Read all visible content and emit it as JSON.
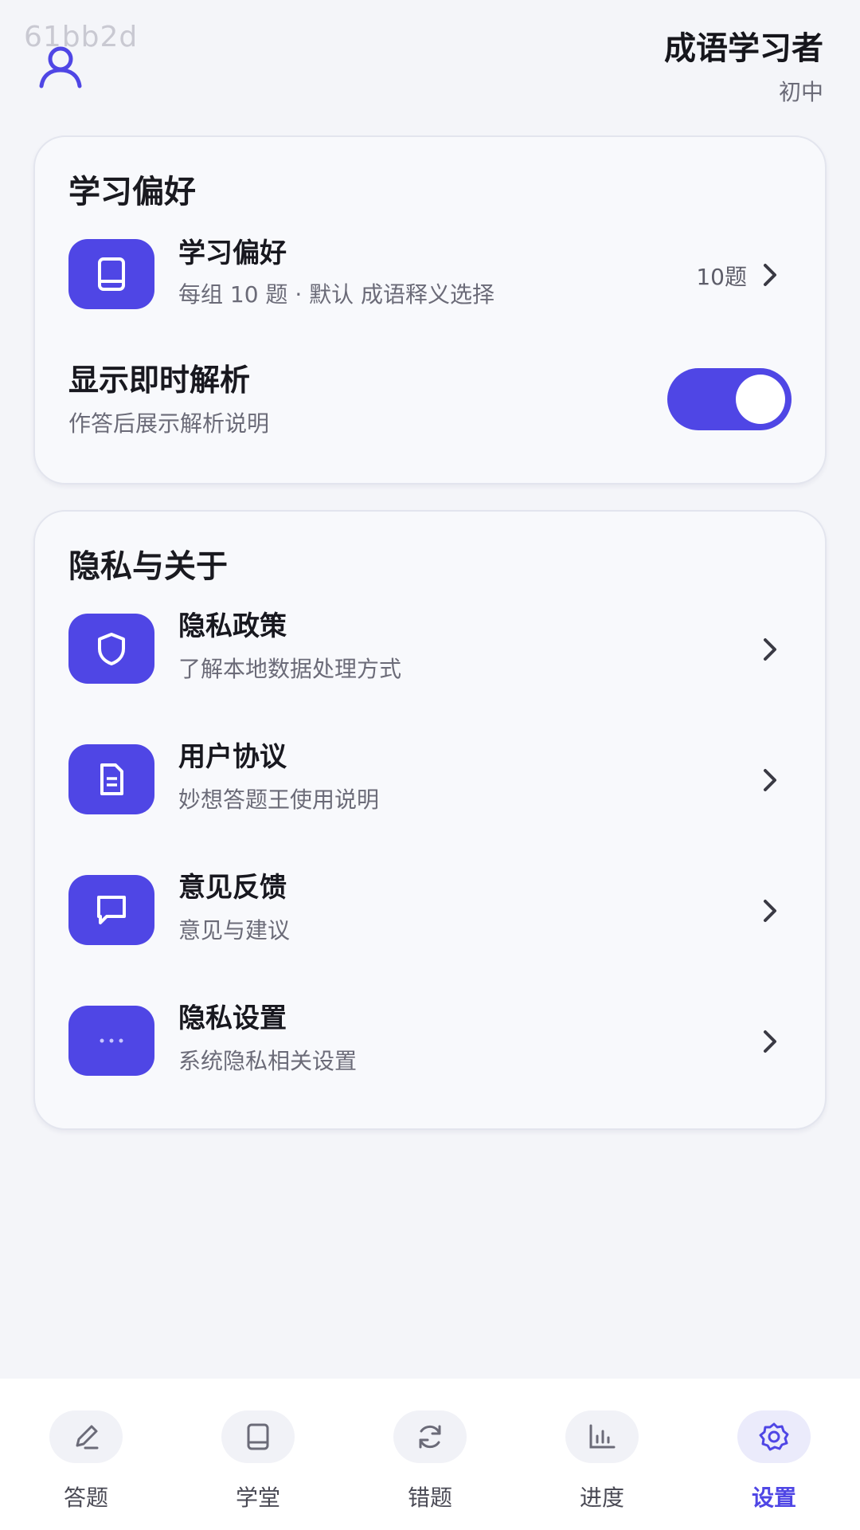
{
  "watermark": "61bb2d",
  "profile": {
    "name": "成语学习者",
    "level": "初中"
  },
  "colors": {
    "accent": "#4f46e5",
    "background": "#f4f5f9",
    "card": "#f8f9fc"
  },
  "learning_card": {
    "title": "学习偏好",
    "preference": {
      "icon": "book-icon",
      "title": "学习偏好",
      "subtitle": "每组 10 题 · 默认 成语释义选择",
      "value": "10题"
    },
    "explanation": {
      "title": "显示即时解析",
      "subtitle": "作答后展示解析说明",
      "enabled": true
    }
  },
  "privacy_card": {
    "title": "隐私与关于",
    "items": [
      {
        "icon": "shield-icon",
        "title": "隐私政策",
        "subtitle": "了解本地数据处理方式"
      },
      {
        "icon": "document-icon",
        "title": "用户协议",
        "subtitle": "妙想答题王使用说明"
      },
      {
        "icon": "message-icon",
        "title": "意见反馈",
        "subtitle": "意见与建议"
      },
      {
        "icon": "more-icon",
        "title": "隐私设置",
        "subtitle": "系统隐私相关设置"
      }
    ]
  },
  "tabs": [
    {
      "label": "答题",
      "icon": "pencil-icon",
      "active": false
    },
    {
      "label": "学堂",
      "icon": "book-icon",
      "active": false
    },
    {
      "label": "错题",
      "icon": "refresh-icon",
      "active": false
    },
    {
      "label": "进度",
      "icon": "bar-chart-icon",
      "active": false
    },
    {
      "label": "设置",
      "icon": "gear-icon",
      "active": true
    }
  ]
}
